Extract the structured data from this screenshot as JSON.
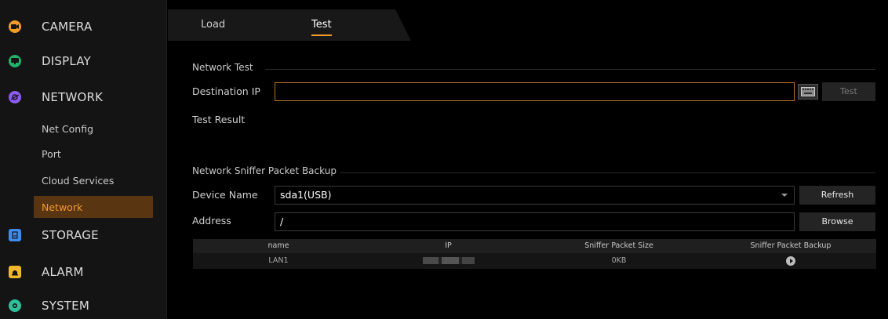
{
  "sidebar": {
    "items": [
      {
        "label": "CAMERA",
        "icon": "camera-icon",
        "color": "#f39a2d"
      },
      {
        "label": "DISPLAY",
        "icon": "display-icon",
        "color": "#1fb36b"
      },
      {
        "label": "NETWORK",
        "icon": "network-icon",
        "color": "#8e5cf5"
      },
      {
        "label": "STORAGE",
        "icon": "storage-icon",
        "color": "#3d8cf0"
      },
      {
        "label": "ALARM",
        "icon": "alarm-icon",
        "color": "#f0b82d"
      },
      {
        "label": "SYSTEM",
        "icon": "system-icon",
        "color": "#2fc09a"
      }
    ],
    "sub_items": [
      {
        "label": "Net Config"
      },
      {
        "label": "Port"
      },
      {
        "label": "Cloud Services"
      },
      {
        "label": "Network",
        "active": true
      }
    ]
  },
  "tabs": [
    {
      "label": "Load"
    },
    {
      "label": "Test",
      "active": true
    }
  ],
  "network_test": {
    "section_title": "Network Test",
    "dest_ip_label": "Destination IP",
    "dest_ip_value": "",
    "test_button": "Test",
    "result_label": "Test Result"
  },
  "sniffer": {
    "section_title": "Network Sniffer Packet Backup",
    "device_label": "Device Name",
    "device_value": "sda1(USB)",
    "refresh_button": "Refresh",
    "address_label": "Address",
    "address_value": "/",
    "browse_button": "Browse",
    "columns": [
      "name",
      "IP",
      "Sniffer Packet Size",
      "Sniffer Packet Backup"
    ],
    "rows": [
      {
        "name": "LAN1",
        "ip": "",
        "size": "0KB",
        "backup_icon": "play-icon"
      }
    ]
  },
  "accent_color": "#f39a2d"
}
